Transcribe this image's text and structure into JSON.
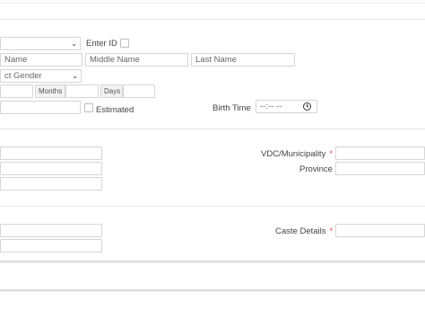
{
  "personal": {
    "enter_id_label": "Enter ID",
    "first_name_placeholder": "Name",
    "middle_name_placeholder": "Middle Name",
    "last_name_placeholder": "Last Name",
    "gender_select_value": "ct Gender",
    "months_label": "Months",
    "days_label": "Days",
    "estimated_label": "Estimated",
    "birth_time_label": "Birth Time",
    "birth_time_value": "--:-- --"
  },
  "address": {
    "vdc_label": "VDC/Municipality",
    "province_label": "Province",
    "required_mark": "*"
  },
  "caste": {
    "caste_label": "Caste Details",
    "required_mark": "*"
  }
}
